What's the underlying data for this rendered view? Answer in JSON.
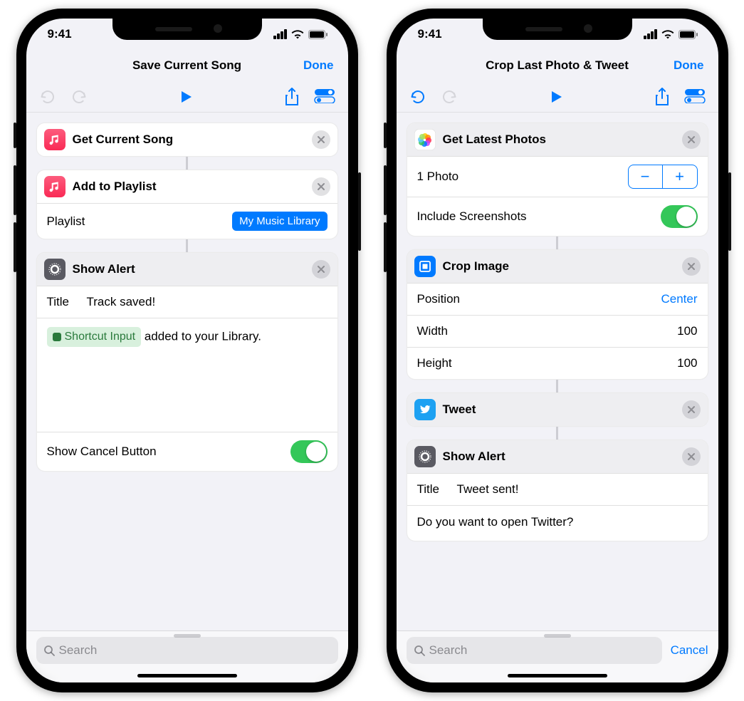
{
  "status": {
    "time": "9:41"
  },
  "phone1": {
    "nav": {
      "title": "Save Current Song",
      "done": "Done"
    },
    "search": {
      "placeholder": "Search"
    },
    "actions": {
      "getSong": {
        "label": "Get Current Song"
      },
      "addPlaylist": {
        "label": "Add to Playlist",
        "paramLabel": "Playlist",
        "paramValue": "My Music Library"
      },
      "alert": {
        "label": "Show Alert",
        "titleLabel": "Title",
        "titleValue": "Track saved!",
        "tokenLabel": "Shortcut Input",
        "bodySuffix": " added to your Library.",
        "cancelLabel": "Show Cancel Button"
      }
    }
  },
  "phone2": {
    "nav": {
      "title": "Crop Last Photo & Tweet",
      "done": "Done"
    },
    "search": {
      "placeholder": "Search",
      "cancel": "Cancel"
    },
    "actions": {
      "latest": {
        "label": "Get Latest Photos",
        "countLabel": "1 Photo",
        "screenshotLabel": "Include Screenshots"
      },
      "crop": {
        "label": "Crop Image",
        "positionLabel": "Position",
        "positionValue": "Center",
        "widthLabel": "Width",
        "widthValue": "100",
        "heightLabel": "Height",
        "heightValue": "100"
      },
      "tweet": {
        "label": "Tweet"
      },
      "alert": {
        "label": "Show Alert",
        "titleLabel": "Title",
        "titleValue": "Tweet sent!",
        "body": "Do you want to open Twitter?"
      }
    }
  }
}
